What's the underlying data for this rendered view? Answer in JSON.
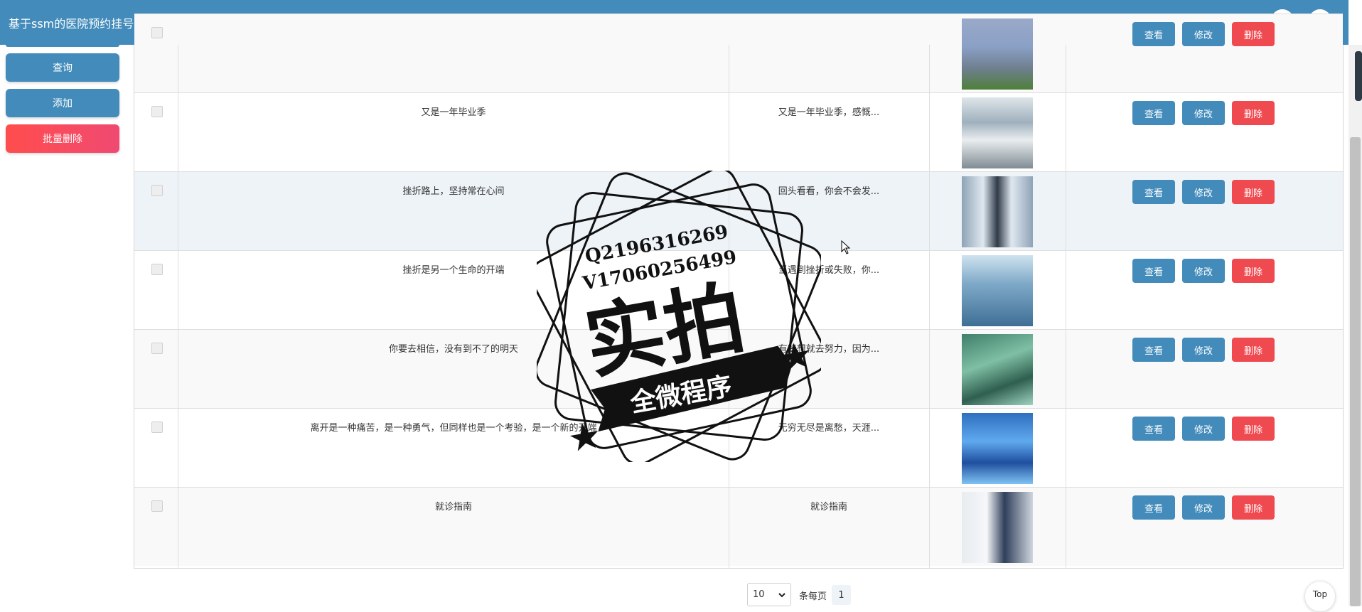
{
  "header": {
    "app_title": "基于ssm的医院预约挂号管理系统",
    "icons": [
      "fullscreen-icon",
      "user-icon"
    ]
  },
  "sidebar": {
    "buttons": [
      {
        "label": "查询",
        "color": "#428bba"
      },
      {
        "label": "添加",
        "color": "#428bba"
      },
      {
        "label": "批量删除",
        "color": "#f04a51"
      }
    ]
  },
  "table": {
    "rows": [
      {
        "title": "",
        "summary": "",
        "selected": false,
        "image_theme": "hospital-building"
      },
      {
        "title": "又是一年毕业季",
        "summary": "又是一年毕业季，感慨...",
        "selected": false,
        "image_theme": "hospital-lobby"
      },
      {
        "title": "挫折路上，坚持常在心间",
        "summary": "回头看看，你会不会发...",
        "selected": false,
        "image_theme": "hospital-corridor",
        "highlighted": true
      },
      {
        "title": "挫折是另一个生命的开端",
        "summary": "当遇到挫折或失败，你...",
        "selected": false,
        "image_theme": "operating-room"
      },
      {
        "title": "你要去相信，没有到不了的明天",
        "summary": "有梦想就去努力，因为...",
        "selected": false,
        "image_theme": "surgery-team"
      },
      {
        "title": "离开是一种痛苦，是一种勇气，但同样也是一个考验，是一个新的开端",
        "summary": "无穷无尽是离愁，天涯...",
        "selected": false,
        "image_theme": "surgery-lights"
      },
      {
        "title": "就诊指南",
        "summary": "就诊指南",
        "selected": false,
        "image_theme": "doctor-consult"
      }
    ],
    "actions": {
      "view": "查看",
      "edit": "修改",
      "delete": "删除"
    }
  },
  "pagination": {
    "page_size": "10",
    "per_page_label": "条每页",
    "current_page": "1"
  },
  "back_to_top": "Top",
  "watermark": {
    "contact_q": "Q2196316269",
    "contact_v": "V17060256499",
    "main_text": "实拍",
    "banner_text": "全微程序"
  },
  "colors": {
    "primary": "#428bba",
    "danger": "#f04a51",
    "highlight_row": "#eef3f8"
  }
}
